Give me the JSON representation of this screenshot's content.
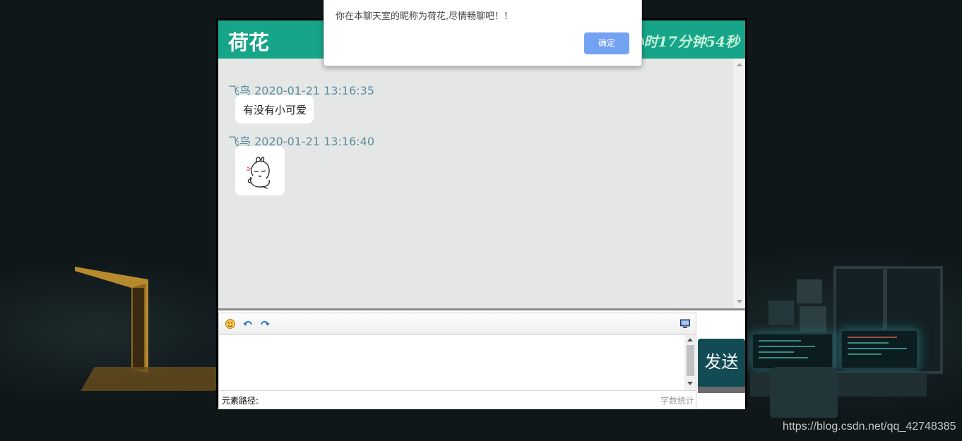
{
  "dialog": {
    "message": "你在本聊天室的昵称为荷花,尽情畅聊吧！！",
    "ok_label": "确定"
  },
  "header": {
    "title": "荷花",
    "online_timer": "小时17分钟54秒",
    "color": "#17a589"
  },
  "messages": [
    {
      "sender": "飞鸟",
      "time": "2020-01-21 13:16:35",
      "meta": "飞鸟 2020-01-21 13:16:35",
      "text": "有没有小可爱",
      "type": "text"
    },
    {
      "sender": "飞鸟",
      "time": "2020-01-21 13:16:40",
      "meta": "飞鸟 2020-01-21 13:16:40",
      "type": "sticker",
      "sticker": "rabbit-sticker"
    }
  ],
  "editor": {
    "toolbar": [
      {
        "icon": "emoji-icon"
      },
      {
        "icon": "undo-icon"
      },
      {
        "icon": "redo-icon"
      },
      {
        "icon": "fullscreen-icon"
      }
    ],
    "path_label": "元素路径:",
    "word_count_label": "字数统计"
  },
  "send_label": "发送",
  "send_color": "#124b53",
  "watermark": "https://blog.csdn.net/qq_42748385"
}
